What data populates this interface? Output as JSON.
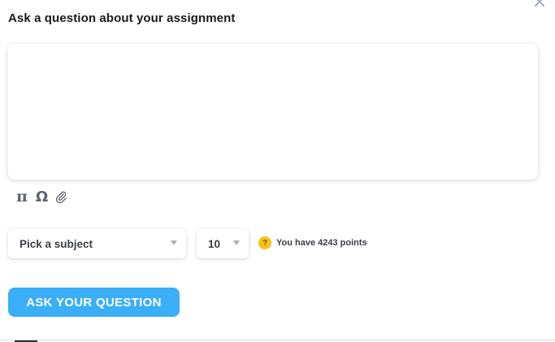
{
  "dialog": {
    "title": "Ask a question about your assignment",
    "close_icon": "close-icon"
  },
  "editor": {
    "value": "",
    "placeholder": "",
    "tools": [
      {
        "name": "pi-symbol",
        "glyph": "π"
      },
      {
        "name": "omega-symbol",
        "glyph": "Ω"
      },
      {
        "name": "paperclip-icon",
        "glyph": "paperclip"
      }
    ]
  },
  "subject_select": {
    "selected": "Pick a subject"
  },
  "points_select": {
    "selected": "10"
  },
  "points_info": {
    "icon": "coin-icon",
    "coin_glyph": "?",
    "text": "You have 4243 points"
  },
  "submit": {
    "label": "ASK YOUR QUESTION"
  },
  "colors": {
    "accent": "#3aaef6",
    "coin": "#f6c21b",
    "text_dark": "#1a1a1a",
    "icon_gray": "#5d6570"
  }
}
